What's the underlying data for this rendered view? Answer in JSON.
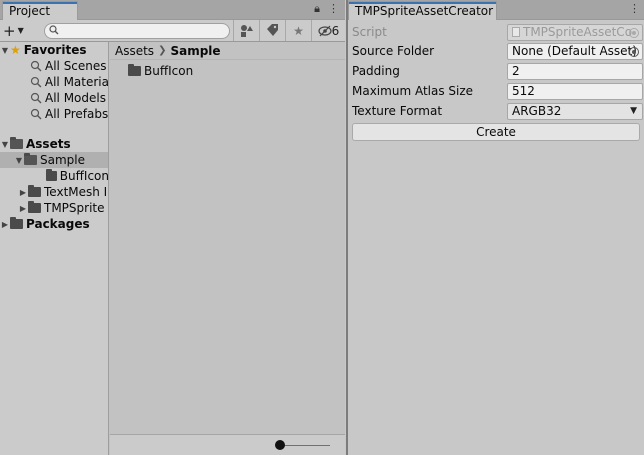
{
  "project": {
    "tab_title": "Project",
    "toolbar": {
      "hidden_count": "6",
      "search_placeholder": ""
    },
    "tree": {
      "favorites_label": "Favorites",
      "favorites": [
        "All Scenes",
        "All Materia",
        "All Models",
        "All Prefabs"
      ],
      "assets_label": "Assets",
      "sample_label": "Sample",
      "bufficon_label": "BuffIcon",
      "textmesh_label": "TextMesh I",
      "tmpsprite_label": "TMPSprite",
      "packages_label": "Packages"
    },
    "breadcrumb": {
      "root": "Assets",
      "current": "Sample"
    },
    "content_items": [
      "BuffIcon"
    ]
  },
  "inspector": {
    "tab_title": "TMPSpriteAssetCreator",
    "fields": {
      "script_label": "Script",
      "script_value": "TMPSpriteAssetCo",
      "source_folder_label": "Source Folder",
      "source_folder_value": "None (Default Asset)",
      "padding_label": "Padding",
      "padding_value": "2",
      "max_atlas_label": "Maximum Atlas Size",
      "max_atlas_value": "512",
      "texture_format_label": "Texture Format",
      "texture_format_value": "ARGB32"
    },
    "create_label": "Create"
  },
  "colors": {
    "accent": "#3a72b0",
    "star": "#e0a000"
  }
}
